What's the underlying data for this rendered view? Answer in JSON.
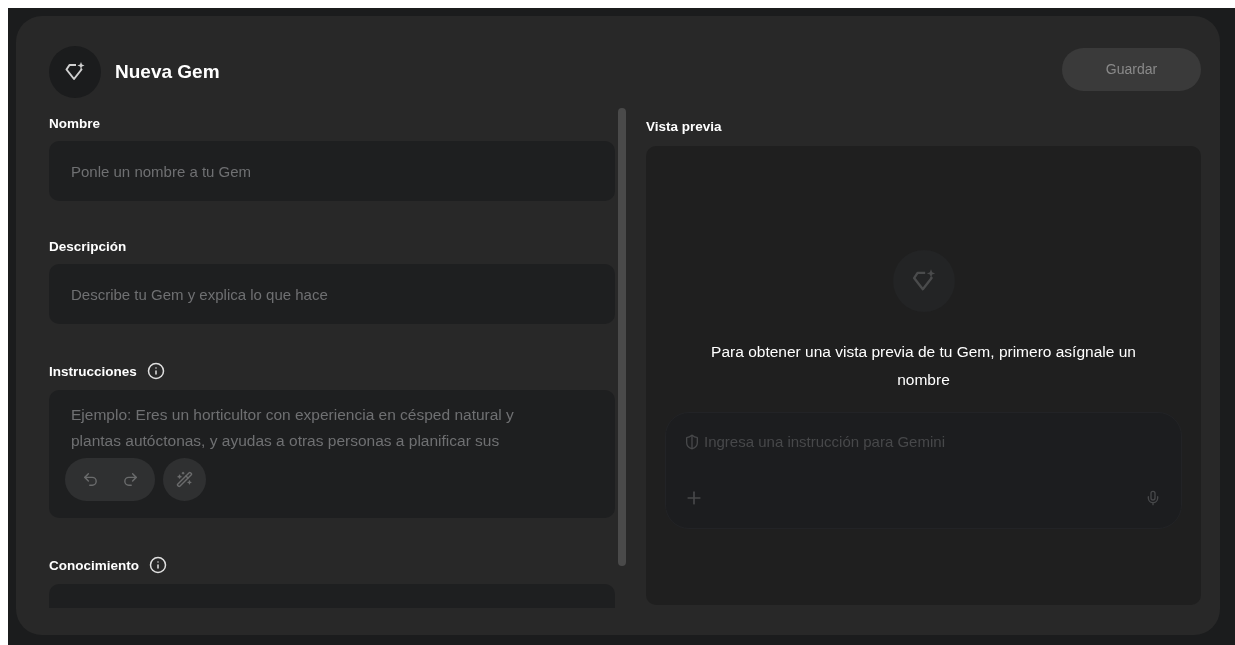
{
  "header": {
    "title": "Nueva Gem",
    "save_button": {
      "label": "Guardar",
      "disabled": true
    }
  },
  "form": {
    "fields": [
      {
        "kind": "input",
        "label": "Nombre",
        "info": false,
        "placeholder": "Ponle un nombre a tu Gem"
      },
      {
        "kind": "input",
        "label": "Descripción",
        "info": false,
        "placeholder": "Describe tu Gem y explica lo que hace"
      },
      {
        "kind": "textarea",
        "label": "Instrucciones",
        "info": true,
        "placeholder": "Ejemplo: Eres un horticultor con experiencia en césped natural y plantas autóctonas, y ayudas a otras personas a planificar sus"
      },
      {
        "kind": "upload",
        "label": "Conocimiento",
        "info": true
      }
    ]
  },
  "preview": {
    "label": "Vista previa",
    "message": "Para obtener una vista previa de tu Gem, primero asígnale un nombre",
    "prompt_placeholder": "Ingresa una instrucción para Gemini"
  }
}
